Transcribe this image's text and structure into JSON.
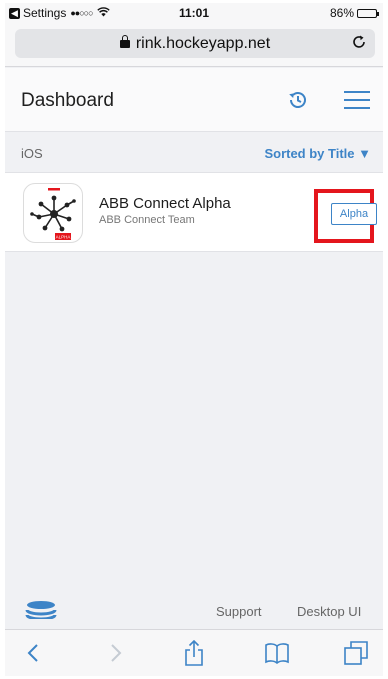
{
  "statusbar": {
    "carrier": "Settings",
    "signal": "●●○○○",
    "time": "11:01",
    "battery": "86%",
    "battery_level": 0.86
  },
  "browser": {
    "url": "rink.hockeyapp.net"
  },
  "header": {
    "title": "Dashboard"
  },
  "section": {
    "platform": "iOS",
    "sort_label": "Sorted by Title ▼"
  },
  "apps": [
    {
      "name": "ABB Connect Alpha",
      "team": "ABB Connect Team",
      "channel": "Alpha",
      "icon_badge": "ALPHA"
    }
  ],
  "footer": {
    "support": "Support",
    "desktop": "Desktop UI"
  },
  "colors": {
    "accent": "#3d84c7",
    "highlight": "#e4161d"
  }
}
